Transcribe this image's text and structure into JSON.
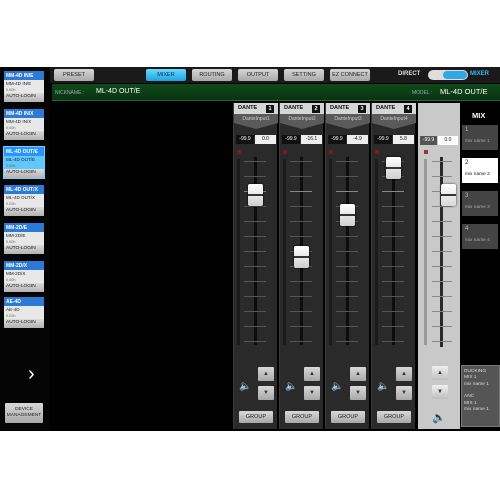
{
  "tabs": [
    "PRESET",
    "MIXER",
    "ROUTING",
    "OUTPUT",
    "SETTING",
    "EZ CONNECT"
  ],
  "mode_toggle": {
    "left": "DIRECT",
    "right": "MIXER"
  },
  "nickname": {
    "label": "NICKNAME :",
    "value": "ML-4D OUT/E"
  },
  "model": {
    "label": "MODEL :",
    "value": "ML-4D OUT/E"
  },
  "devices": [
    {
      "name": "MM-4D IN/E",
      "sub": "MM-4D IN/E",
      "status": "0.00h",
      "button": "AUTO-LOGIN"
    },
    {
      "name": "MM-4D IN/X",
      "sub": "MM-4D IN/X",
      "status": "0.00h",
      "button": "AUTO-LOGIN"
    },
    {
      "name": "ML-4D OUT/E",
      "sub": "ML-4D OUT/E",
      "status": "0.00h",
      "button": "AUTO-LOGIN"
    },
    {
      "name": "ML-4D OUT/X",
      "sub": "ML-4D OUT/X",
      "status": "0.00h",
      "button": "AUTO-LOGIN"
    },
    {
      "name": "MM-2D/E",
      "sub": "MM-2D/E",
      "status": "0.00h",
      "button": "AUTO-LOGIN"
    },
    {
      "name": "MM-2D/X",
      "sub": "MM-2D/X",
      "status": "0.00h",
      "button": "AUTO-LOGIN"
    },
    {
      "name": "AE-4D",
      "sub": "AE-4D",
      "status": "0.00h",
      "button": "AUTO-LOGIN"
    }
  ],
  "nav_chevron": "›",
  "device_management": "DEVICE MANAGEMENT",
  "channels": [
    {
      "label": "DANTE",
      "number": "1",
      "source": "DanteInput1",
      "meter": "-99.9",
      "value": "0.0",
      "fader_pct": 0.8
    },
    {
      "label": "DANTE",
      "number": "2",
      "source": "DanteInput2",
      "meter": "-99.9",
      "value": "-16.1",
      "fader_pct": 0.47
    },
    {
      "label": "DANTE",
      "number": "3",
      "source": "DanteInput3",
      "meter": "-99.9",
      "value": "-4.9",
      "fader_pct": 0.69
    },
    {
      "label": "DANTE",
      "number": "4",
      "source": "DanteInput4",
      "meter": "-99.9",
      "value": "5.8",
      "fader_pct": 0.94
    }
  ],
  "group_label": "GROUP",
  "arrow_up": "▲",
  "arrow_down": "▼",
  "speaker": "🔈",
  "master": {
    "meter": "-99.9",
    "value": "0.0",
    "fader_pct": 0.8
  },
  "mix": {
    "title": "MIX",
    "items": [
      {
        "number": "1",
        "name": "mix name 1",
        "selected": false
      },
      {
        "number": "2",
        "name": "mix name 2",
        "selected": true
      },
      {
        "number": "3",
        "name": "mix name 3",
        "selected": false
      },
      {
        "number": "4",
        "name": "mix name 4",
        "selected": false
      }
    ],
    "ducking": [
      "DUCKING",
      "MIX 1",
      "mix name 1",
      "",
      "ANC",
      "MIX 1",
      "mix name 1"
    ]
  }
}
